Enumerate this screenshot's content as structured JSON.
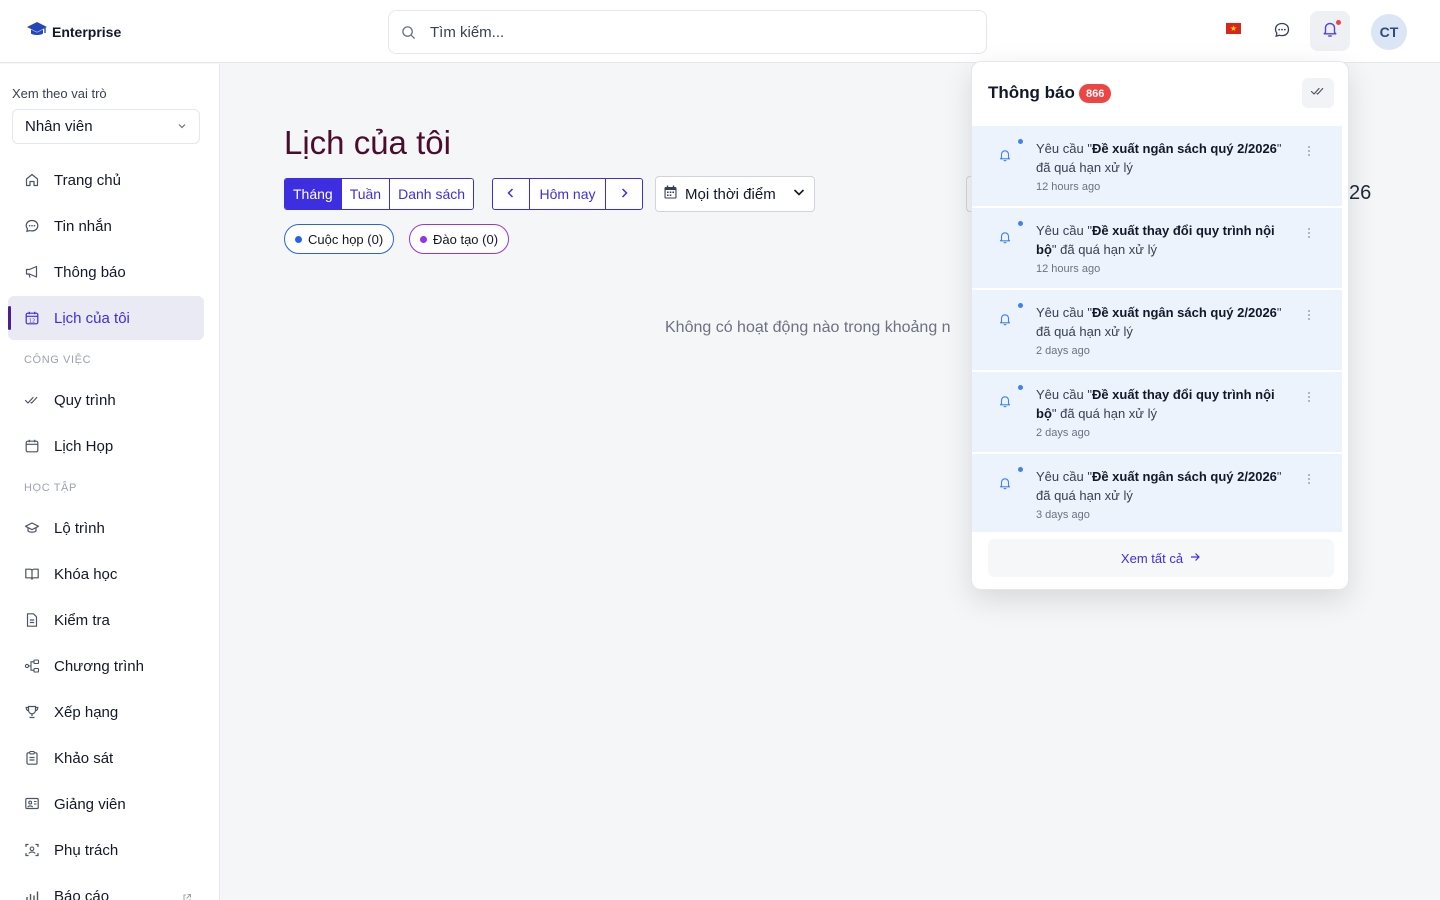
{
  "app": {
    "name": "Enterprise"
  },
  "header": {
    "search_placeholder": "Tìm kiếm...",
    "avatar_initials": "CT"
  },
  "sidebar": {
    "role_label": "Xem theo vai trò",
    "role_value": "Nhân viên",
    "items": [
      {
        "label": "Trang chủ",
        "icon": "home-icon"
      },
      {
        "label": "Tin nhắn",
        "icon": "chat-icon"
      },
      {
        "label": "Thông báo",
        "icon": "megaphone-icon"
      },
      {
        "label": "Lịch của tôi",
        "icon": "calendar-icon",
        "active": true
      }
    ],
    "section_work": "CÔNG VIỆC",
    "work_items": [
      {
        "label": "Quy trình",
        "icon": "checks-icon"
      },
      {
        "label": "Lịch Họp",
        "icon": "calendar-icon"
      }
    ],
    "section_learning": "HỌC TẬP",
    "learning_items": [
      {
        "label": "Lộ trình",
        "icon": "graduation-cap-icon"
      },
      {
        "label": "Khóa học",
        "icon": "book-icon"
      },
      {
        "label": "Kiểm tra",
        "icon": "document-icon"
      },
      {
        "label": "Chương trình",
        "icon": "hierarchy-icon"
      },
      {
        "label": "Xếp hạng",
        "icon": "trophy-icon"
      },
      {
        "label": "Khảo sát",
        "icon": "clipboard-icon"
      },
      {
        "label": "Giảng viên",
        "icon": "presentation-icon"
      },
      {
        "label": "Phụ trách",
        "icon": "user-scan-icon"
      },
      {
        "label": "Báo cáo",
        "icon": "chart-icon"
      }
    ]
  },
  "main": {
    "title": "Lịch của tôi",
    "view_tabs": [
      "Tháng",
      "Tuần",
      "Danh sách"
    ],
    "selected_view": "Tháng",
    "today_label": "Hôm nay",
    "time_filter": "Mọi thời điểm",
    "filters": [
      {
        "label": "Cuộc họp (0)",
        "color": "#2563eb"
      },
      {
        "label": "Đào tạo (0)",
        "color": "#9333ea"
      }
    ],
    "empty_message": "Không có hoạt động nào trong khoảng n",
    "partial_year_text": "26"
  },
  "notifications": {
    "title": "Thông báo",
    "count": "866",
    "items": [
      {
        "prefix": "Yêu cầu \"",
        "bold": "Đề xuất ngân sách quý 2/2026",
        "suffix": "\" đã quá hạn xử lý",
        "time": "12 hours ago"
      },
      {
        "prefix": "Yêu cầu \"",
        "bold": "Đề xuất thay đổi quy trình nội bộ",
        "suffix": "\" đã quá hạn xử lý",
        "time": "12 hours ago"
      },
      {
        "prefix": "Yêu cầu \"",
        "bold": "Đề xuất ngân sách quý 2/2026",
        "suffix": "\" đã quá hạn xử lý",
        "time": "2 days ago"
      },
      {
        "prefix": "Yêu cầu \"",
        "bold": "Đề xuất thay đổi quy trình nội bộ",
        "suffix": "\" đã quá hạn xử lý",
        "time": "2 days ago"
      },
      {
        "prefix": "Yêu cầu \"",
        "bold": "Đề xuất ngân sách quý 2/2026",
        "suffix": "\" đã quá hạn xử lý",
        "time": "3 days ago"
      }
    ],
    "view_all": "Xem tất cả"
  },
  "colors": {
    "accent": "#3d2fe0",
    "title": "#4a0d2e",
    "badge": "#ef4444",
    "notif_bg": "#edf3fd"
  }
}
